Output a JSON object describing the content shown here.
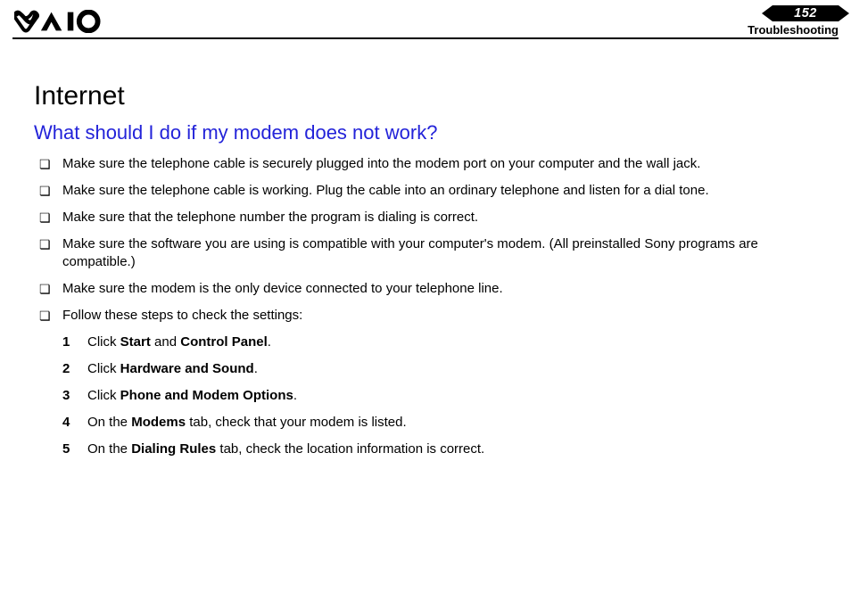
{
  "header": {
    "page_number": "152",
    "section": "Troubleshooting"
  },
  "content": {
    "title": "Internet",
    "subtitle": "What should I do if my modem does not work?",
    "bullets": [
      "Make sure the telephone cable is securely plugged into the modem port on your computer and the wall jack.",
      "Make sure the telephone cable is working. Plug the cable into an ordinary telephone and listen for a dial tone.",
      "Make sure that the telephone number the program is dialing is correct.",
      "Make sure the software you are using is compatible with your computer's modem. (All preinstalled Sony programs are compatible.)",
      "Make sure the modem is the only device connected to your telephone line.",
      "Follow these steps to check the settings:"
    ],
    "steps": [
      {
        "pre": "Click ",
        "b1": "Start",
        "mid": " and ",
        "b2": "Control Panel",
        "post": "."
      },
      {
        "pre": "Click ",
        "b1": "Hardware and Sound",
        "mid": "",
        "b2": "",
        "post": "."
      },
      {
        "pre": "Click ",
        "b1": "Phone and Modem Options",
        "mid": "",
        "b2": "",
        "post": "."
      },
      {
        "pre": "On the ",
        "b1": "Modems",
        "mid": " tab, check that your modem is listed.",
        "b2": "",
        "post": ""
      },
      {
        "pre": "On the ",
        "b1": "Dialing Rules",
        "mid": " tab, check the location information is correct.",
        "b2": "",
        "post": ""
      }
    ]
  }
}
